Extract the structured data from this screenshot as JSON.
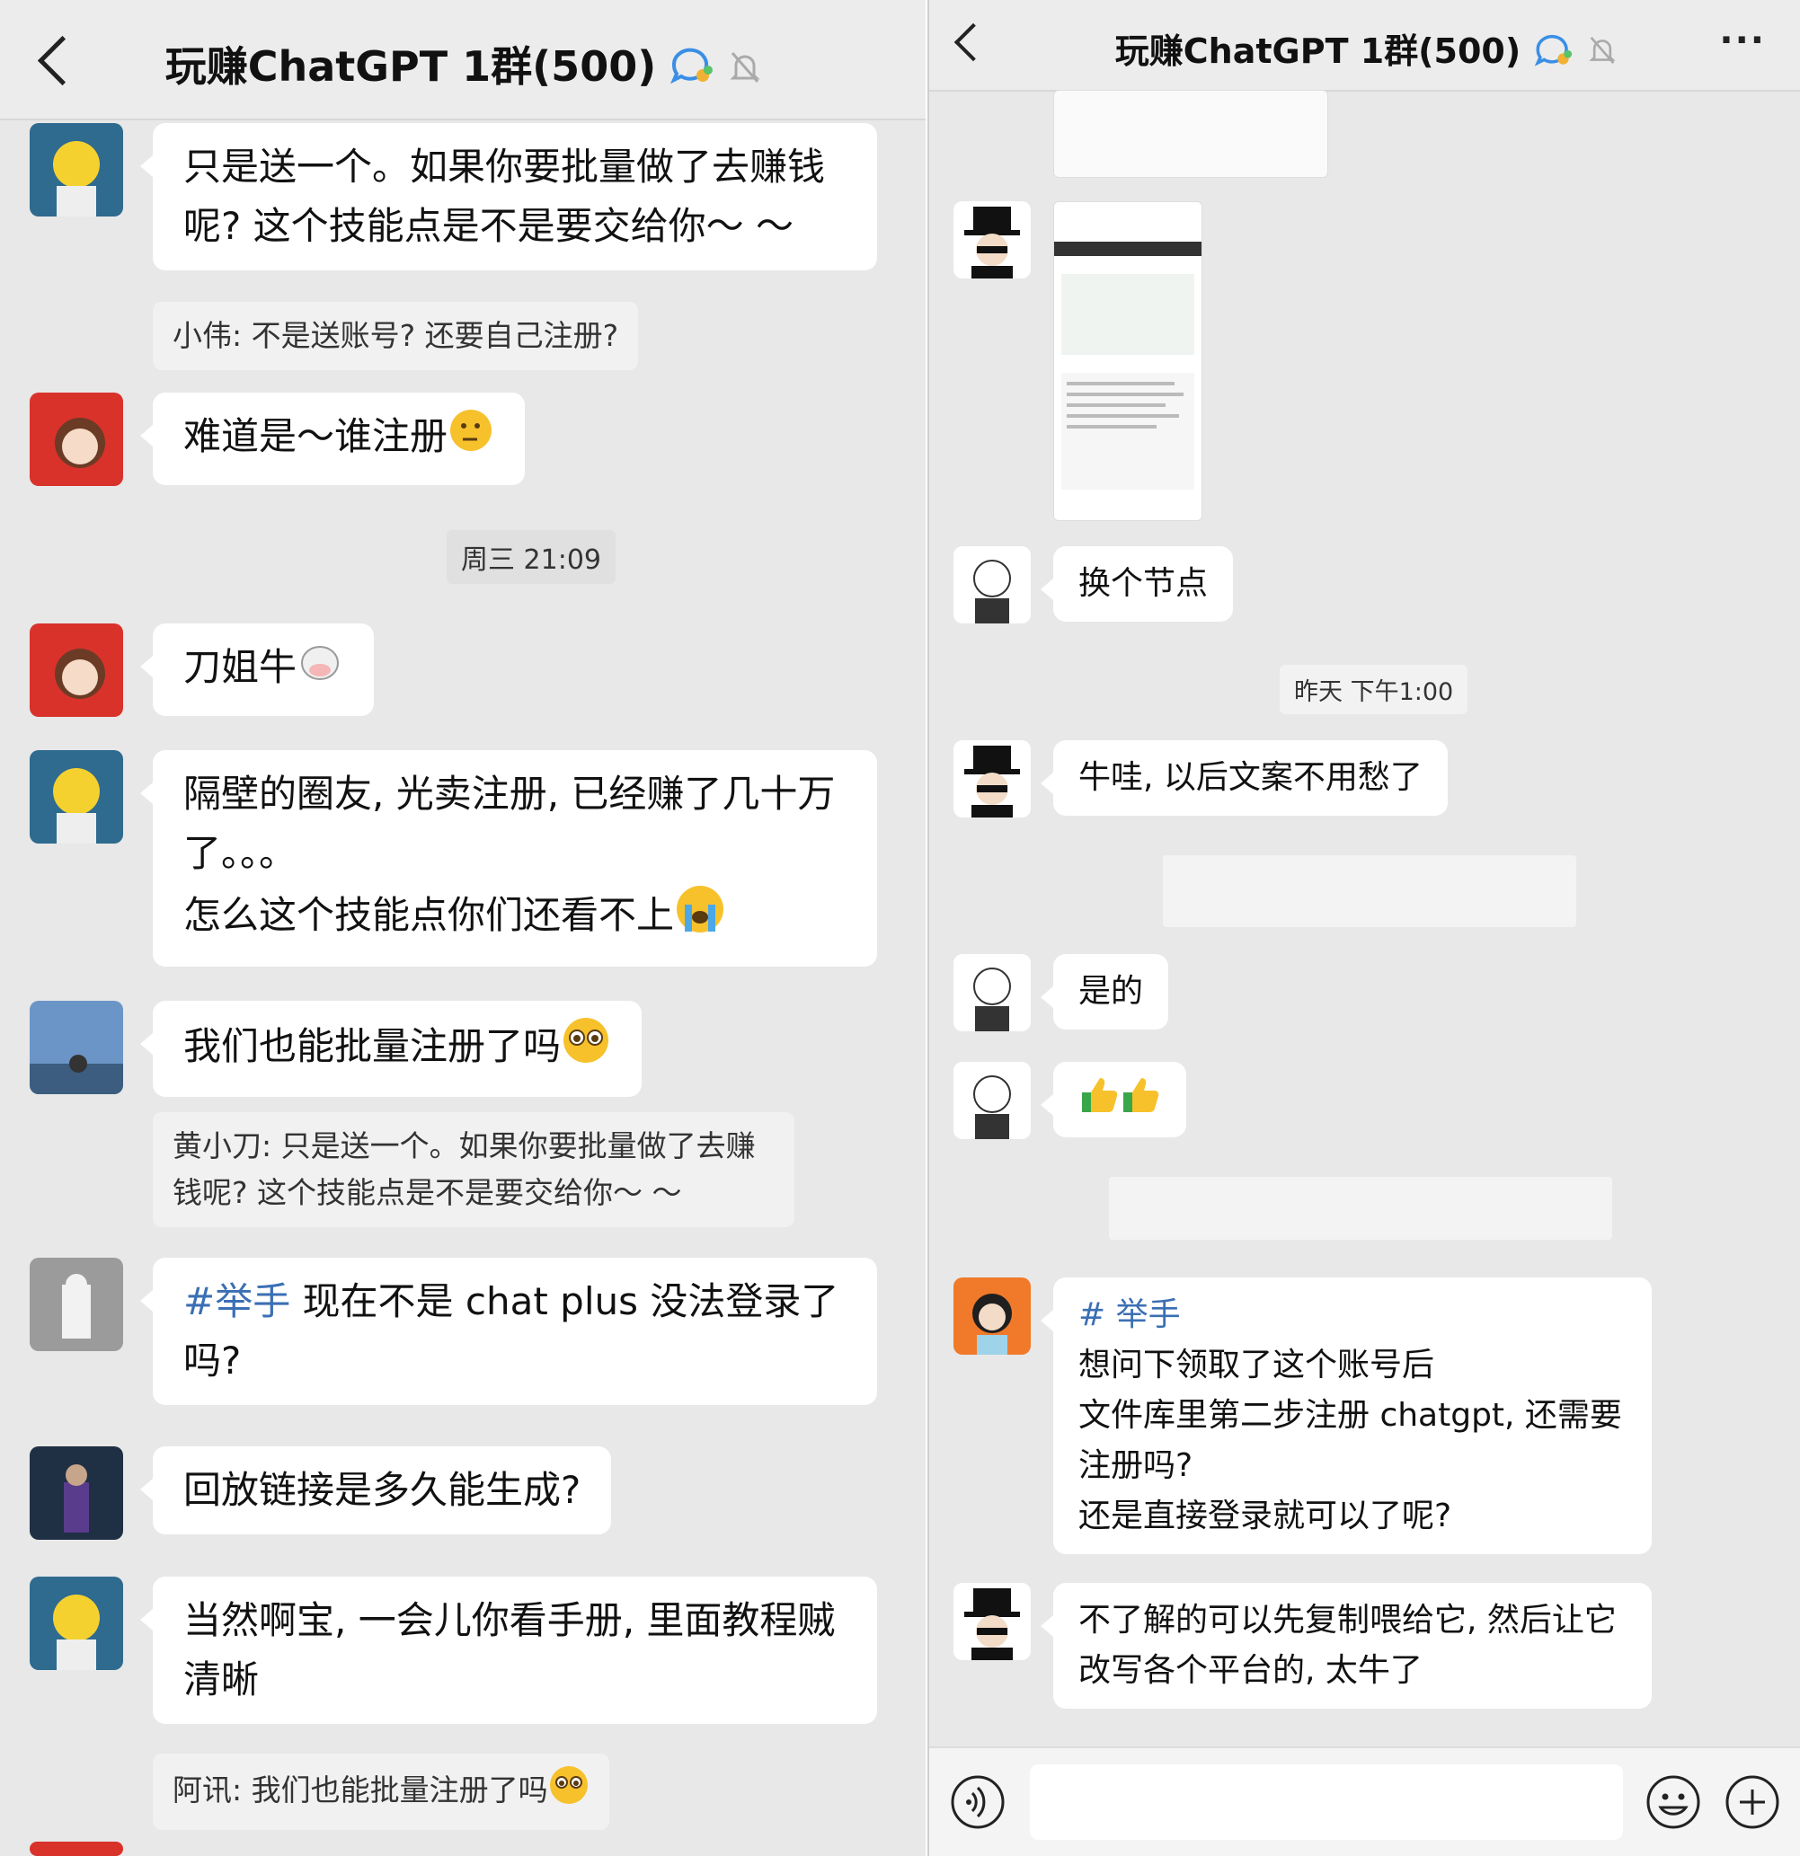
{
  "left": {
    "header": {
      "title": "玩赚ChatGPT 1群(500)"
    },
    "messages": [
      {
        "text": "只是送一个。如果你要批量做了去赚钱呢? 这个技能点是不是要交给你～ ～"
      },
      {
        "quote": "小伟: 不是送账号? 还要自己注册?"
      },
      {
        "text": "难道是～谁注册"
      },
      {
        "time": "周三 21:09"
      },
      {
        "text": "刀姐牛"
      },
      {
        "text1": "隔壁的圈友, 光卖注册, 已经赚了几十万了。。。",
        "text2": "怎么这个技能点你们还看不上"
      },
      {
        "text": "我们也能批量注册了吗"
      },
      {
        "quote": "黄小刀: 只是送一个。如果你要批量做了去赚钱呢? 这个技能点是不是要交给你～ ～"
      },
      {
        "tag": "#举手",
        "text": " 现在不是 chat plus 没法登录了吗?"
      },
      {
        "text": "回放链接是多久能生成?"
      },
      {
        "text": "当然啊宝, 一会儿你看手册, 里面教程贼清晰"
      },
      {
        "quote": "阿讯: 我们也能批量注册了吗"
      }
    ]
  },
  "right": {
    "header": {
      "title": "玩赚ChatGPT 1群(500)",
      "more": "···"
    },
    "messages": [
      {
        "text": "换个节点"
      },
      {
        "time": "昨天 下午1:00"
      },
      {
        "text": "牛哇, 以后文案不用愁了"
      },
      {
        "text": "是的"
      },
      {
        "tag": "# 举手",
        "lines": [
          "想问下领取了这个账号后",
          "文件库里第二步注册 chatgpt, 还需要注册吗?",
          "还是直接登录就可以了呢?"
        ]
      },
      {
        "text": "不了解的可以先复制喂给它, 然后让它改写各个平台的, 太牛了"
      }
    ]
  },
  "colors": {
    "tag": "#3b6fb4",
    "bg": "#e8e8e8",
    "bubble": "#ffffff"
  },
  "icons": [
    "back-arrow-icon",
    "group-chat-icon",
    "mute-bell-icon",
    "more-icon",
    "voice-icon",
    "emoji-icon",
    "plus-icon"
  ]
}
